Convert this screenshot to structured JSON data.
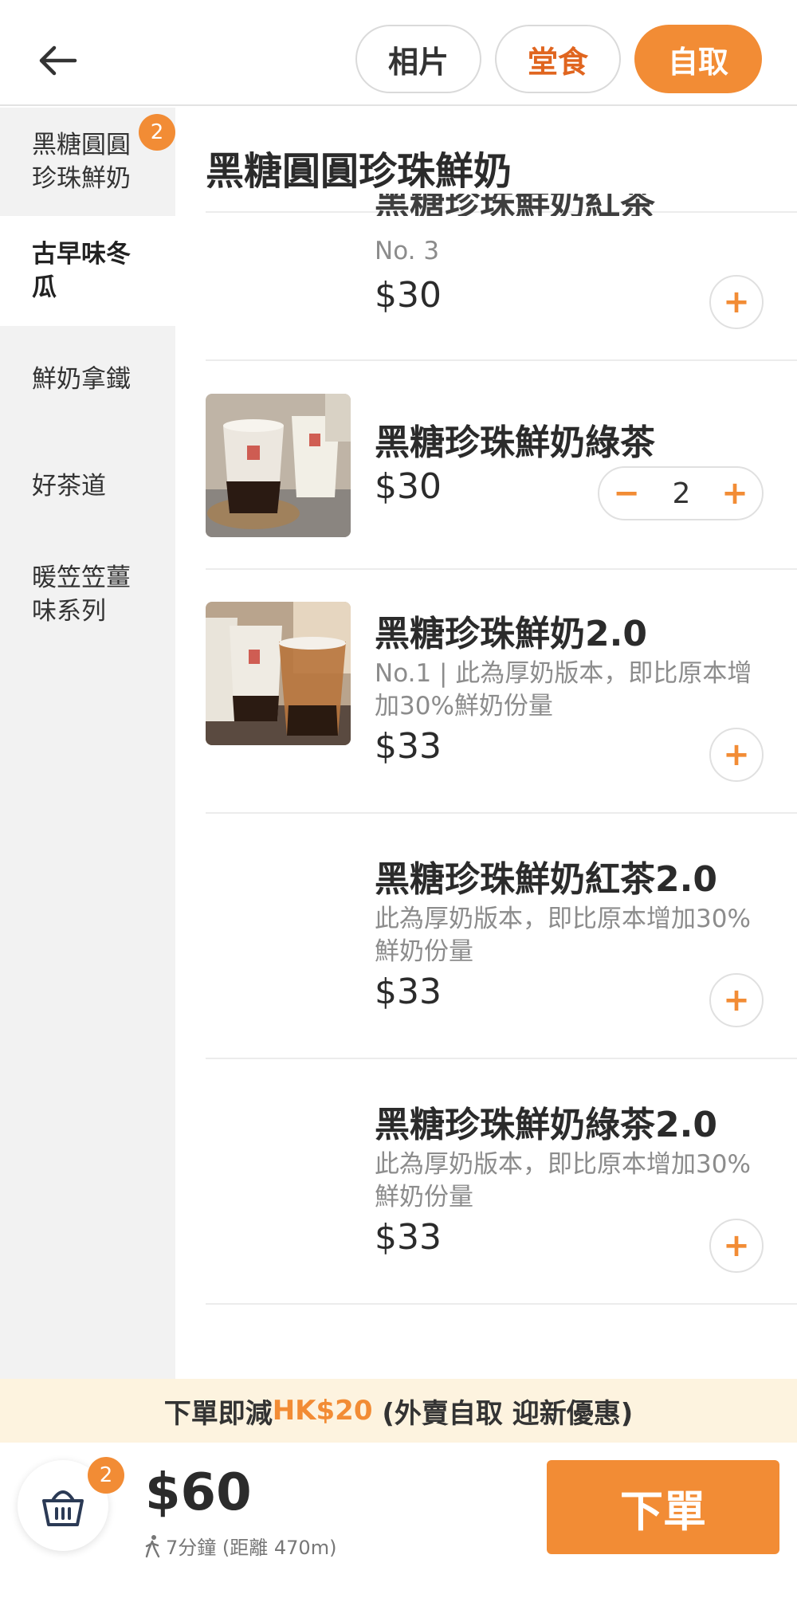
{
  "header": {
    "back_icon": "arrow-left-icon",
    "tabs": [
      {
        "label": "相片"
      },
      {
        "label": "堂食"
      },
      {
        "label": "自取"
      }
    ]
  },
  "sidebar": {
    "items": [
      {
        "label": "黑糖圓圓珍珠鮮奶",
        "badge": "2"
      },
      {
        "label": "古早味冬瓜"
      },
      {
        "label": "鮮奶拿鐵"
      },
      {
        "label": "好茶道"
      },
      {
        "label": "暖笠笠薑味系列"
      }
    ]
  },
  "section": {
    "title": "黑糖圓圓珍珠鮮奶"
  },
  "items": [
    {
      "name": "黑糖珍珠鮮奶紅茶",
      "desc": "No. 3",
      "price": "$30"
    },
    {
      "name": "黑糖珍珠鮮奶綠茶",
      "price": "$30",
      "qty": "2"
    },
    {
      "name": "黑糖珍珠鮮奶2.0",
      "desc": "No.1 | 此為厚奶版本，即比原本增加30%鮮奶份量",
      "price": "$33"
    },
    {
      "name": "黑糖珍珠鮮奶紅茶2.0",
      "desc": "此為厚奶版本，即比原本增加30%鮮奶份量",
      "price": "$33"
    },
    {
      "name": "黑糖珍珠鮮奶綠茶2.0",
      "desc": "此為厚奶版本，即比原本增加30%鮮奶份量",
      "price": "$33"
    }
  ],
  "promo": {
    "prefix": "下單即減",
    "amount": "HK$20",
    "suffix": " (外賣自取 迎新優惠)"
  },
  "cart": {
    "badge": "2",
    "total": "$60",
    "eta": "7分鐘 (距離 470m)",
    "order_label": "下單"
  },
  "colors": {
    "accent": "#f28c35",
    "dine_text": "#e0651f",
    "promo_bg": "#fdf3df"
  }
}
